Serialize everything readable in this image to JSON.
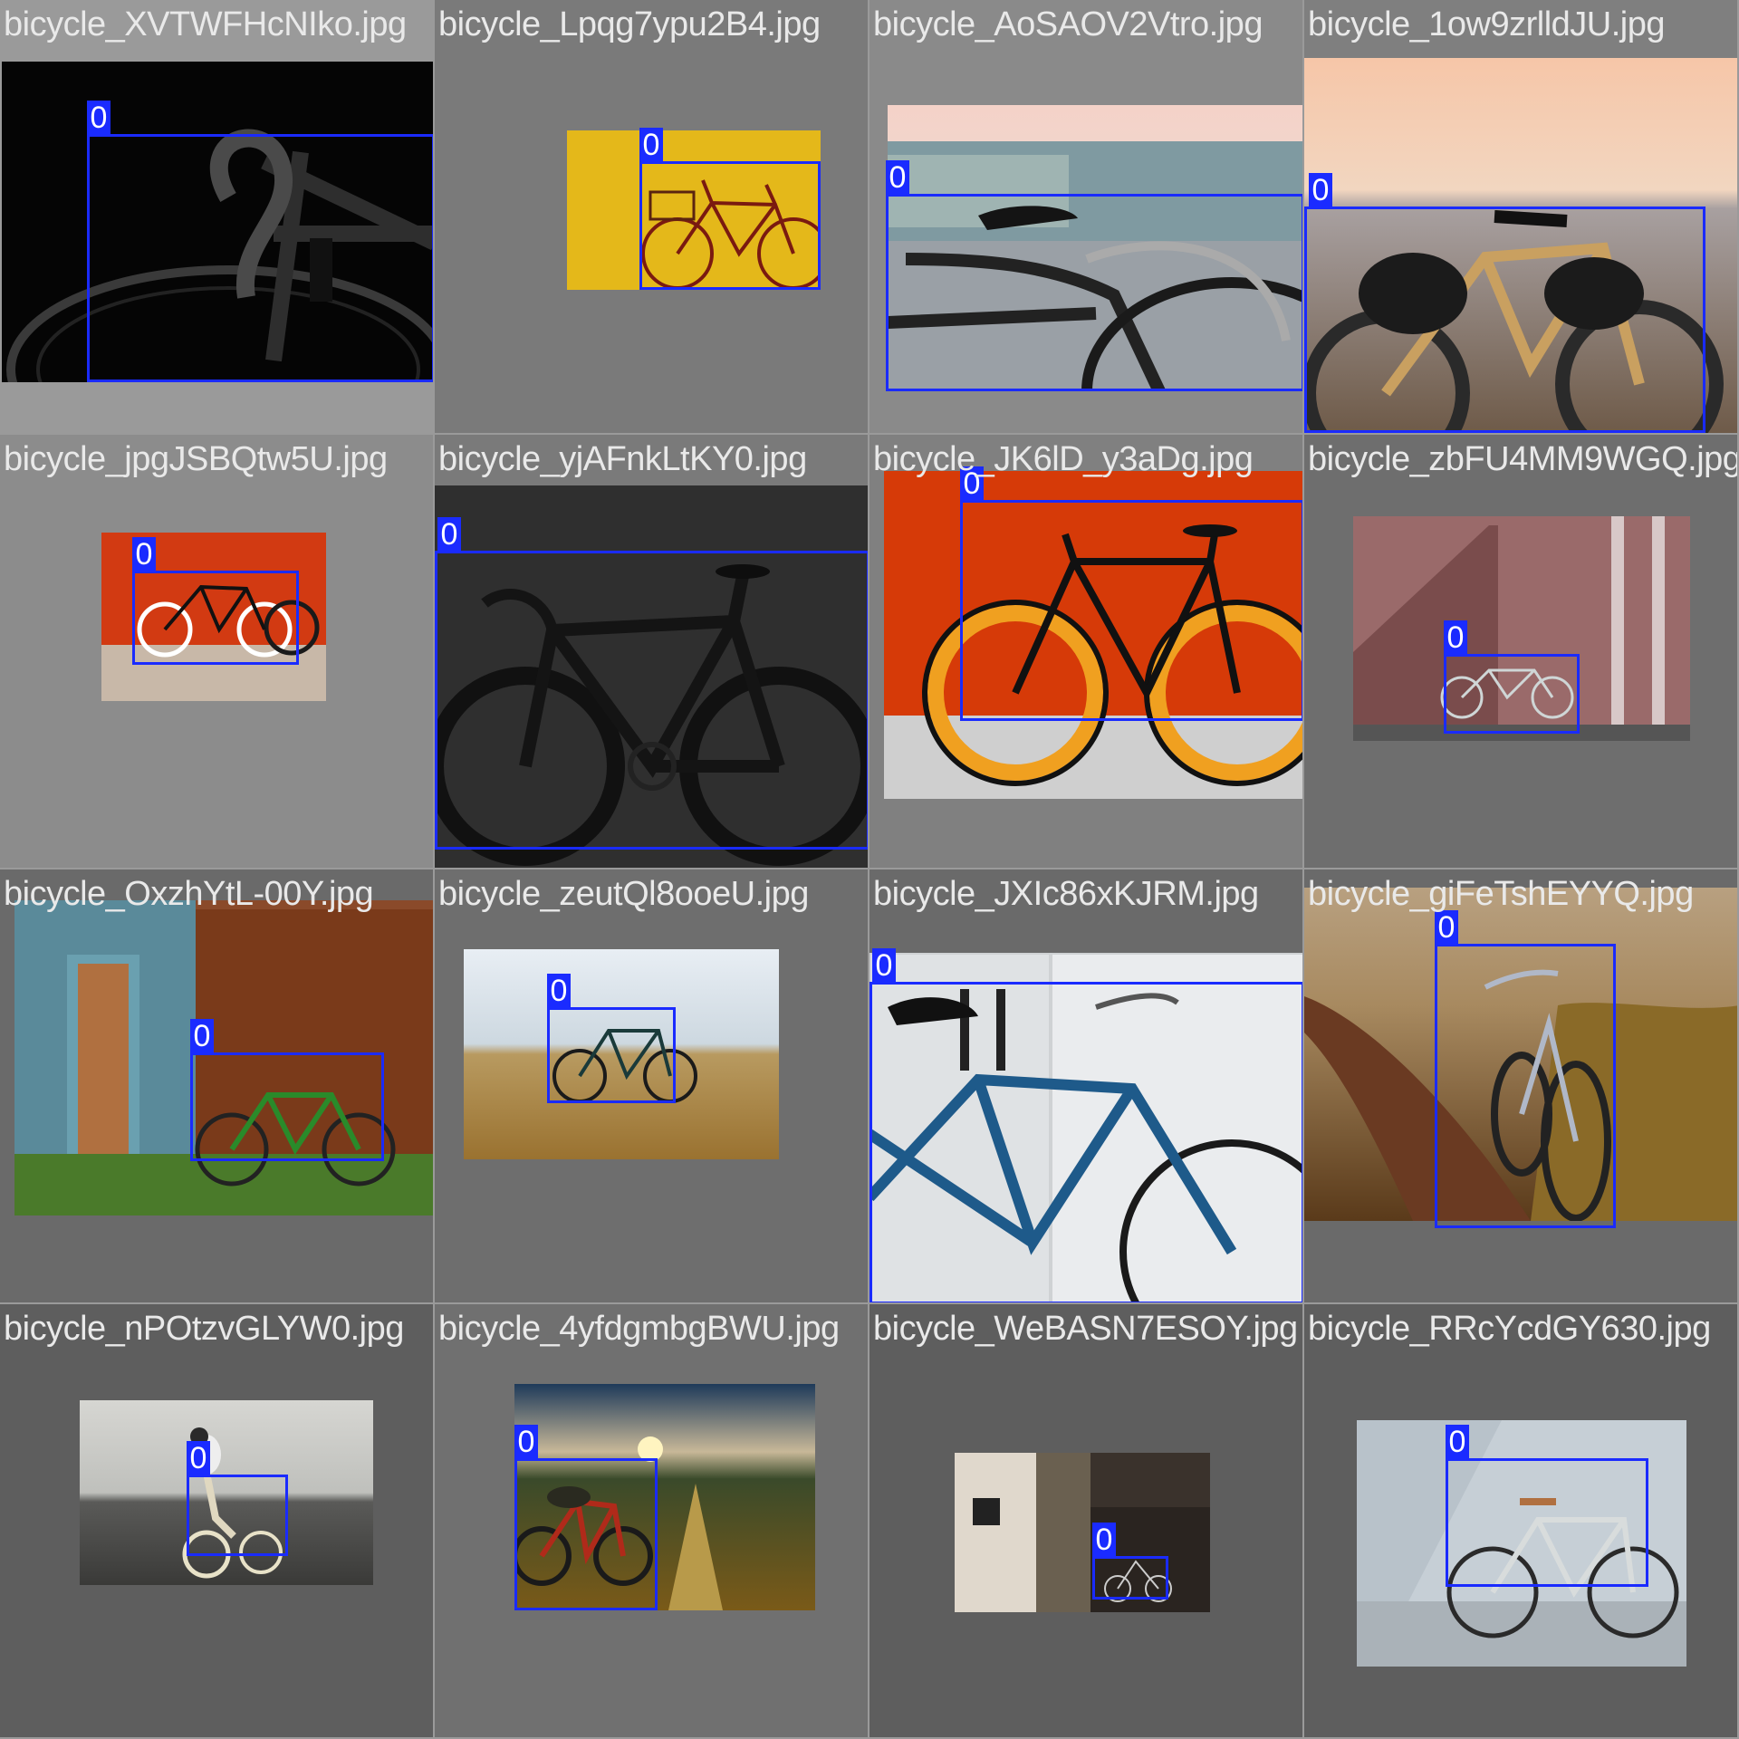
{
  "tiles": [
    {
      "filename": "bicycle_XVTWFHcNIko.jpg",
      "bg": "#9a9a9a",
      "label": "0",
      "scene": "dark-handlebar"
    },
    {
      "filename": "bicycle_Lpqg7ypu2B4.jpg",
      "bg": "#7a7a7a",
      "label": "0",
      "scene": "yellow-wall"
    },
    {
      "filename": "bicycle_AoSAOV2Vtro.jpg",
      "bg": "#8a8a8a",
      "label": "0",
      "scene": "street-saddle"
    },
    {
      "filename": "bicycle_1ow9zrlldJU.jpg",
      "bg": "#7f7f7f",
      "label": "0",
      "scene": "sunset-touring"
    },
    {
      "filename": "bicycle_jpgJSBQtw5U.jpg",
      "bg": "#8c8c8c",
      "label": "0",
      "scene": "red-wall-two-bikes"
    },
    {
      "filename": "bicycle_yjAFnkLtKY0.jpg",
      "bg": "#7a7a7a",
      "label": "0",
      "scene": "black-road-bike"
    },
    {
      "filename": "bicycle_JK6lD_y3aDg.jpg",
      "bg": "#808080",
      "label": "0",
      "scene": "orange-wheels"
    },
    {
      "filename": "bicycle_zbFU4MM9WGQ.jpg",
      "bg": "#6e6e6e",
      "label": "0",
      "scene": "pink-house"
    },
    {
      "filename": "bicycle_OxzhYtL-00Y.jpg",
      "bg": "#6a6a6a",
      "label": "0",
      "scene": "wooden-shed"
    },
    {
      "filename": "bicycle_zeutQl8ooeU.jpg",
      "bg": "#6e6e6e",
      "label": "0",
      "scene": "beach"
    },
    {
      "filename": "bicycle_JXIc86xKJRM.jpg",
      "bg": "#6a6a6a",
      "label": "0",
      "scene": "blue-tandem"
    },
    {
      "filename": "bicycle_giFeTshEYYQ.jpg",
      "bg": "#6a6a6a",
      "label": "0",
      "scene": "dirt-road"
    },
    {
      "filename": "bicycle_nPOtzvGLYW0.jpg",
      "bg": "#5e5e5e",
      "label": "0",
      "scene": "rider-road"
    },
    {
      "filename": "bicycle_4yfdgmbgBWU.jpg",
      "bg": "#707070",
      "label": "0",
      "scene": "field-sunset"
    },
    {
      "filename": "bicycle_WeBASN7ESOY.jpg",
      "bg": "#5e5e5e",
      "label": "0",
      "scene": "shadow-rider"
    },
    {
      "filename": "bicycle_RRcYcdGY630.jpg",
      "bg": "#5e5e5e",
      "label": "0",
      "scene": "white-wall-bike"
    }
  ],
  "colors": {
    "box": "#1a2bff",
    "label_text": "#ffffff",
    "filename_text": "#e9e9e9"
  }
}
